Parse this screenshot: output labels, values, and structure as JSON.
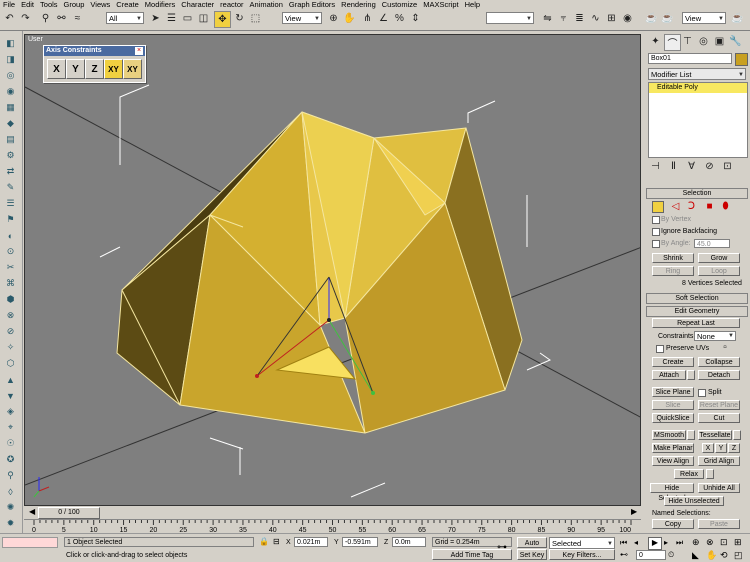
{
  "menu": [
    "File",
    "Edit",
    "Tools",
    "Group",
    "Views",
    "Create",
    "Modifiers",
    "Character",
    "reactor",
    "Animation",
    "Graph Editors",
    "Rendering",
    "Customize",
    "MAXScript",
    "Help"
  ],
  "toolbar": {
    "selection_filter": "All",
    "ref_coord": "View",
    "view_right": "View"
  },
  "viewport": {
    "label": "User"
  },
  "axis_constraints": {
    "title": "Axis Constraints",
    "buttons": [
      "X",
      "Y",
      "Z",
      "XY",
      "XY"
    ]
  },
  "command_panel": {
    "object_name": "Box01",
    "modifier_list": "Modifier List",
    "stack_item": "Editable Poly",
    "selection": {
      "title": "Selection",
      "by_vertex": "By Vertex",
      "ignore_backfacing": "Ignore Backfacing",
      "by_angle": "By Angle:",
      "by_angle_value": "45.0",
      "shrink": "Shrink",
      "grow": "Grow",
      "ring": "Ring",
      "loop": "Loop",
      "status": "8 Vertices Selected"
    },
    "soft_selection": "Soft Selection",
    "edit_geometry": {
      "title": "Edit Geometry",
      "repeat_last": "Repeat Last",
      "constraints_label": "Constraints:",
      "constraints_value": "None",
      "preserve_uvs": "Preserve UVs",
      "create": "Create",
      "collapse": "Collapse",
      "attach": "Attach",
      "detach": "Detach",
      "slice_plane": "Slice Plane",
      "split": "Split",
      "slice": "Slice",
      "reset_plane": "Reset Plane",
      "quickslice": "QuickSlice",
      "cut": "Cut",
      "msmooth": "MSmooth",
      "tessellate": "Tessellate",
      "make_planar": "Make Planar",
      "x": "X",
      "y": "Y",
      "z": "Z",
      "view_align": "View Align",
      "grid_align": "Grid Align",
      "relax": "Relax",
      "hide_selected": "Hide Selected",
      "unhide_all": "Unhide All",
      "hide_unselected": "Hide Unselected",
      "named_selections": "Named Selections:",
      "copy": "Copy",
      "paste": "Paste"
    }
  },
  "timeline": {
    "frame": "0 / 100",
    "ticks": [
      "0",
      "5",
      "10",
      "15",
      "20",
      "25",
      "30",
      "35",
      "40",
      "45",
      "50",
      "55",
      "60",
      "65",
      "70",
      "75",
      "80",
      "85",
      "90",
      "95",
      "100"
    ]
  },
  "status": {
    "selection": "1 Object Selected",
    "prompt": "Click or click-and-drag to select objects",
    "x_label": "X",
    "x": "0.021m",
    "y_label": "Y",
    "y": "-0.591m",
    "z_label": "Z",
    "z": "0.0m",
    "grid": "Grid = 0.254m",
    "add_time_tag": "Add Time Tag",
    "auto_key": "Auto Key",
    "set_key": "Set Key",
    "key_mode": "Selected",
    "key_filters": "Key Filters...",
    "frame_field": "0"
  }
}
